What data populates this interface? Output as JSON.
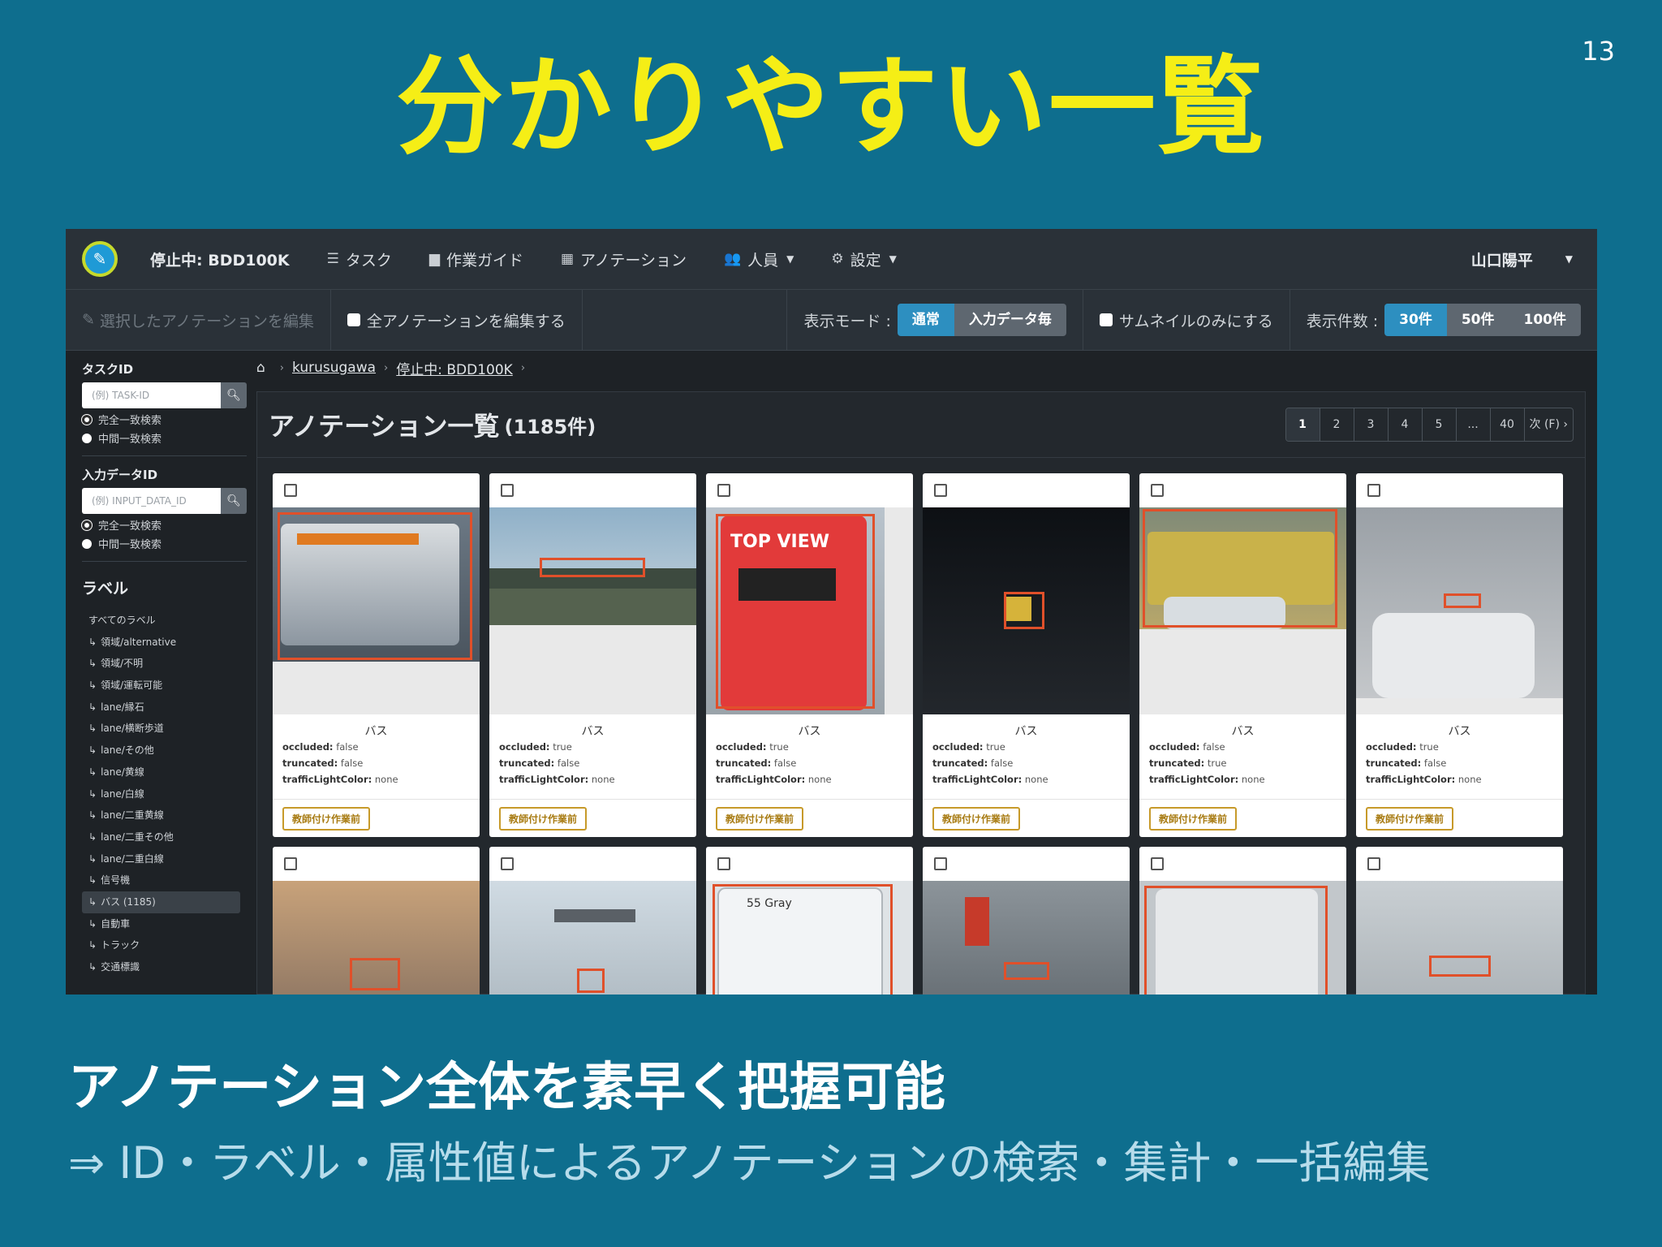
{
  "page_number": "13",
  "title": "分かりやすい一覧",
  "navbar": {
    "status": "停止中: BDD100K",
    "items": [
      {
        "icon": "list-icon",
        "glyph": "☰",
        "label": "タスク",
        "dropdown": false
      },
      {
        "icon": "file-icon",
        "glyph": "▆",
        "label": "作業ガイド",
        "dropdown": false
      },
      {
        "icon": "table-icon",
        "glyph": "▦",
        "label": "アノテーション",
        "dropdown": false
      },
      {
        "icon": "users-icon",
        "glyph": "👥",
        "label": "人員",
        "dropdown": true
      },
      {
        "icon": "gear-icon",
        "glyph": "⚙",
        "label": "設定",
        "dropdown": true
      }
    ],
    "user": "山口陽平"
  },
  "toolbar": {
    "edit_selected": "選択したアノテーションを編集",
    "edit_all": "全アノテーションを編集する",
    "display_mode_label": "表示モード :",
    "mode_normal": "通常",
    "mode_per_input": "入力データ毎",
    "thumbnail_only": "サムネイルのみにする",
    "count_label": "表示件数 :",
    "count_30": "30件",
    "count_50": "50件",
    "count_100": "100件"
  },
  "sidebar": {
    "task_id_heading": "タスクID",
    "task_id_placeholder": "(例) TASK-ID",
    "input_id_heading": "入力データID",
    "input_id_placeholder": "(例) INPUT_DATA_ID",
    "exact_match": "完全一致検索",
    "partial_match": "中間一致検索",
    "label_heading": "ラベル",
    "all_labels": "すべてのラベル",
    "labels": [
      "領域/alternative",
      "領域/不明",
      "領域/運転可能",
      "lane/縁石",
      "lane/横断歩道",
      "lane/その他",
      "lane/黄線",
      "lane/白線",
      "lane/二重黄線",
      "lane/二重その他",
      "lane/二重白線",
      "信号機",
      "バス (1185)",
      "自動車",
      "トラック",
      "交通標識"
    ],
    "active_label_index": 12
  },
  "breadcrumb": {
    "project": "kurusugawa",
    "task": "停止中: BDD100K"
  },
  "panel": {
    "title": "アノテーション一覧",
    "count": "(1185件)"
  },
  "pagination": [
    "1",
    "2",
    "3",
    "4",
    "5",
    "...",
    "40",
    "次 (F) ›"
  ],
  "attribute_keys": {
    "occluded": "occluded:",
    "truncated": "truncated:",
    "traffic": "trafficLightColor:"
  },
  "cards": [
    {
      "label": "バス",
      "occluded": "false",
      "truncated": "false",
      "traffic": "none",
      "status": "教師付け作業前",
      "scene": "bus-front"
    },
    {
      "label": "バス",
      "occluded": "true",
      "truncated": "false",
      "traffic": "none",
      "status": "教師付け作業前",
      "scene": "overpass"
    },
    {
      "label": "バス",
      "occluded": "true",
      "truncated": "false",
      "traffic": "none",
      "status": "教師付け作業前",
      "scene": "red-bus"
    },
    {
      "label": "バス",
      "occluded": "true",
      "truncated": "false",
      "traffic": "none",
      "status": "教師付け作業前",
      "scene": "night"
    },
    {
      "label": "バス",
      "occluded": "false",
      "truncated": "true",
      "traffic": "none",
      "status": "教師付け作業前",
      "scene": "school-bus"
    },
    {
      "label": "バス",
      "occluded": "true",
      "truncated": "false",
      "traffic": "none",
      "status": "教師付け作業前",
      "scene": "street-car"
    },
    {
      "scene": "sunset"
    },
    {
      "scene": "sign-street"
    },
    {
      "scene": "bus-rear-55"
    },
    {
      "scene": "city-traffic"
    },
    {
      "scene": "bus-rear-gray"
    },
    {
      "scene": "haze-road"
    }
  ],
  "subtitle": "アノテーション全体を素早く把握可能",
  "detail": "⇒ ID・ラベル・属性値によるアノテーションの検索・集計・一括編集"
}
